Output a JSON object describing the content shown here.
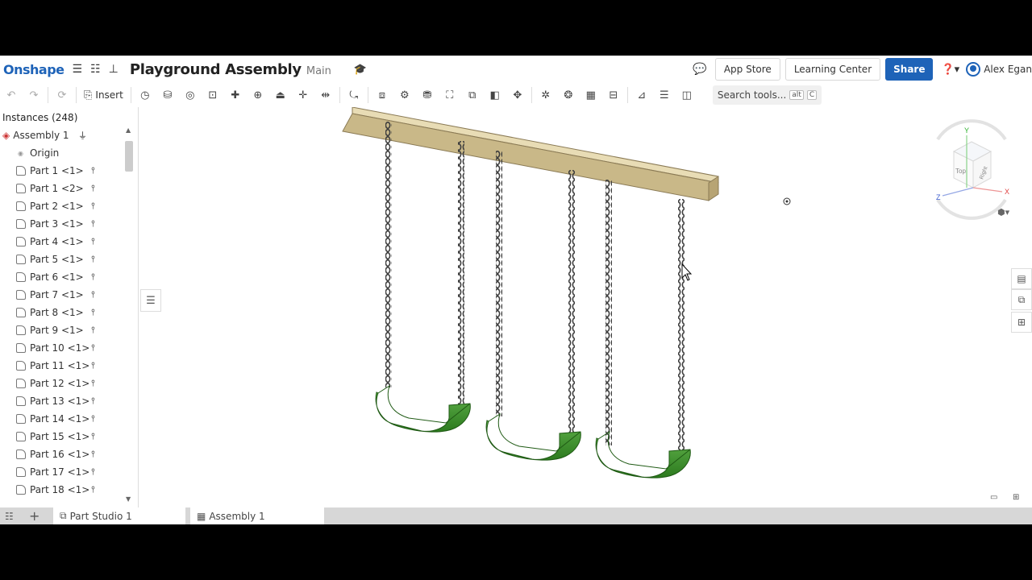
{
  "header": {
    "brand": "Onshape",
    "document_title": "Playground Assembly",
    "branch": "Main",
    "app_store": "App Store",
    "learning_center": "Learning Center",
    "share": "Share",
    "user_name": "Alex Egan"
  },
  "toolbar": {
    "insert_label": "Insert",
    "search_placeholder": "Search tools...",
    "search_shortcut_1": "alt",
    "search_shortcut_2": "C"
  },
  "instances": {
    "header": "Instances (248)",
    "assembly": "Assembly 1",
    "origin": "Origin",
    "parts": [
      "Part 1 <1>",
      "Part 1 <2>",
      "Part 2 <1>",
      "Part 3 <1>",
      "Part 4 <1>",
      "Part 5 <1>",
      "Part 6 <1>",
      "Part 7 <1>",
      "Part 8 <1>",
      "Part 9 <1>",
      "Part 10 <1>",
      "Part 11 <1>",
      "Part 12 <1>",
      "Part 13 <1>",
      "Part 14 <1>",
      "Part 15 <1>",
      "Part 16 <1>",
      "Part 17 <1>",
      "Part 18 <1>"
    ]
  },
  "viewcube": {
    "top": "Top",
    "right": "Right",
    "axis_x": "X",
    "axis_y": "Y",
    "axis_z": "Z"
  },
  "tabs": {
    "part_studio": "Part Studio 1",
    "assembly": "Assembly 1"
  },
  "colors": {
    "brand": "#1e63b8",
    "seat_green": "#3a8a2a",
    "beam": "#d8c9a0",
    "chain": "#555555"
  }
}
